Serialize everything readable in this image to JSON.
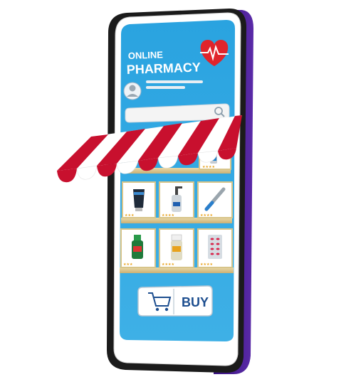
{
  "header": {
    "line1": "ONLINE",
    "line2": "PHARMACY"
  },
  "search": {
    "placeholder": ""
  },
  "products": [
    {
      "name": "spray-bottle",
      "rating": "★★★★"
    },
    {
      "name": "cream-tube",
      "rating": "★★★"
    },
    {
      "name": "pump-bottle",
      "rating": "★★★★"
    },
    {
      "name": "thermometer",
      "rating": "★★★★"
    },
    {
      "name": "green-bottle",
      "rating": "★★★"
    },
    {
      "name": "pill-bottle",
      "rating": "★★★★"
    },
    {
      "name": "blister-pack",
      "rating": "★★★★"
    }
  ],
  "cart": {
    "buy_label": "BUY"
  },
  "colors": {
    "screen_blue": "#2f9fdc",
    "awning_red": "#c8102e",
    "phone_purple": "#4b1d8f",
    "heart_red": "#e0242b",
    "buy_text": "#1d4e8f"
  },
  "icons": [
    "heart-pulse-icon",
    "user-avatar-icon",
    "search-icon",
    "shopping-cart-icon"
  ]
}
